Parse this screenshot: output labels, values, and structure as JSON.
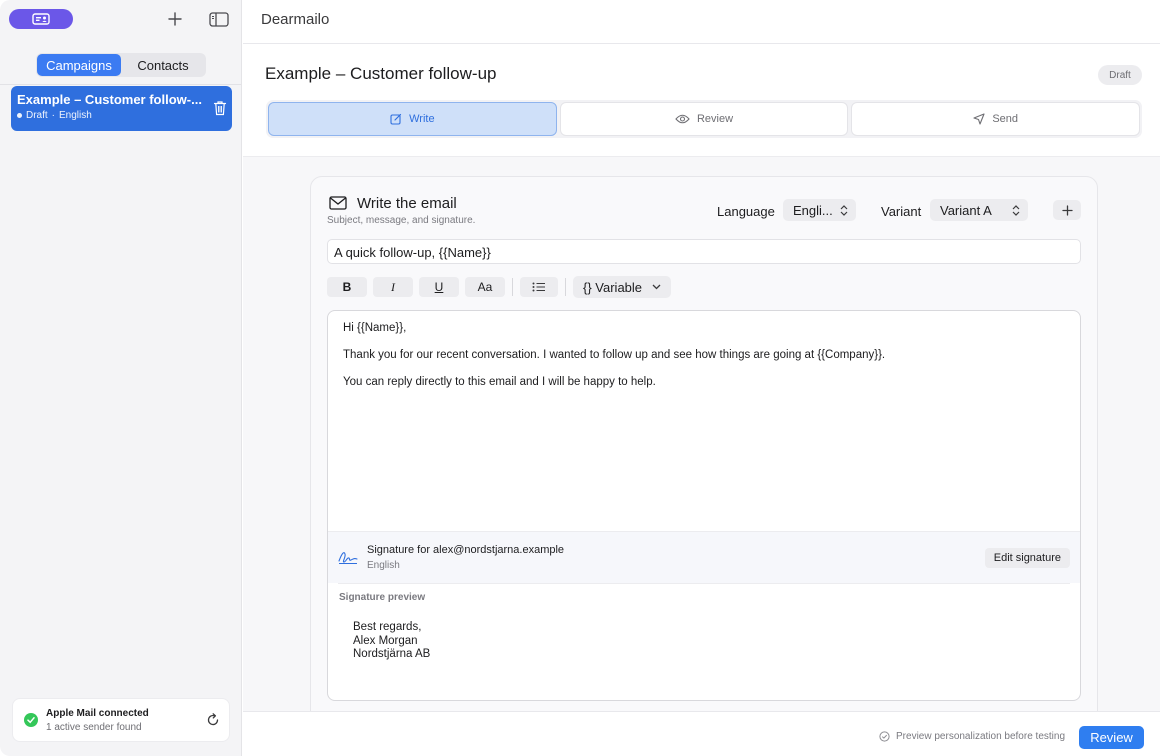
{
  "sidebar": {
    "tabs": [
      {
        "label": "Campaigns",
        "active": true
      },
      {
        "label": "Contacts",
        "active": false
      }
    ],
    "campaigns": [
      {
        "title": "Example – Customer follow-...",
        "status": "Draft",
        "separator": "·",
        "language": "English"
      }
    ],
    "mail_status": {
      "title": "Apple Mail connected",
      "subtitle": "1 active sender found"
    },
    "icons": {
      "profile": "person-card-icon",
      "add": "plus-icon",
      "toggle": "sidebar-toggle-icon",
      "trash": "trash-icon",
      "refresh": "refresh-icon"
    }
  },
  "header": {
    "app_title": "Dearmailo"
  },
  "campaign": {
    "title": "Example – Customer follow-up",
    "badge": "Draft",
    "steps": [
      {
        "label": "Write",
        "icon": "edit-icon",
        "active": true
      },
      {
        "label": "Review",
        "icon": "eye-icon",
        "active": false
      },
      {
        "label": "Send",
        "icon": "send-icon",
        "active": false
      }
    ]
  },
  "editor_card": {
    "title": "Write the email",
    "subtitle": "Subject, message, and signature.",
    "language_label": "Language",
    "language_value": "Engli...",
    "variant_label": "Variant",
    "variant_value": "Variant A",
    "subject": "A quick follow-up, {{Name}}",
    "toolbar": {
      "bold": "B",
      "italic": "I",
      "underline": "U",
      "case": "Aa",
      "variable": "{} Variable"
    },
    "body": [
      "Hi {{Name}},",
      "Thank you for our recent conversation. I wanted to follow up and see how things are going at {{Company}}.",
      "You can reply directly to this email and I will be happy to help."
    ],
    "signature": {
      "title": "Signature for alex@nordstjarna.example",
      "language": "English",
      "edit_label": "Edit signature",
      "preview_label": "Signature preview",
      "preview_lines": [
        "Best regards,",
        "Alex Morgan",
        "Nordstjärna AB"
      ]
    }
  },
  "footer": {
    "hint": "Preview personalization before testing",
    "review_label": "Review"
  },
  "colors": {
    "accent": "#2f6fde",
    "brand_pill": "#6b57e8",
    "success": "#34c759"
  }
}
